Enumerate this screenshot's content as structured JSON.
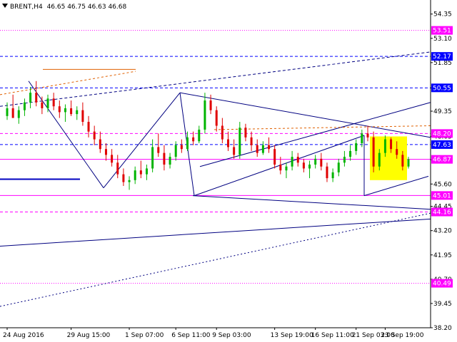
{
  "header": {
    "symbol": "BRENT,H4",
    "ohlc": "46.65 46.75 46.63 46.68"
  },
  "chart_data": {
    "type": "candlestick",
    "title": "BRENT,H4  46.65 46.75 46.63 46.68",
    "ylim": [
      38.2,
      55.0
    ],
    "y_ticks": [
      "54.35",
      "53.10",
      "51.85",
      "50.55",
      "49.35",
      "48.05",
      "46.85",
      "45.60",
      "44.45",
      "43.20",
      "41.95",
      "40.70",
      "39.45",
      "38.20"
    ],
    "x_ticks": [
      "24 Aug 2016",
      "29 Aug 15:00",
      "1 Sep 07:00",
      "6 Sep 11:00",
      "9 Sep 03:00",
      "13 Sep 19:00",
      "16 Sep 11:00",
      "21 Sep 03:00",
      "23 Sep 19:00"
    ],
    "current_price": "46.87",
    "levels": [
      {
        "label": "53.51",
        "value": 53.51,
        "color": "#ff00ff",
        "style": "dotted"
      },
      {
        "label": "52.17",
        "value": 52.17,
        "color": "#0000ff",
        "style": "dashed"
      },
      {
        "label": "50.55",
        "value": 50.55,
        "color": "#0000ff",
        "style": "dashed"
      },
      {
        "label": "48.20",
        "value": 48.2,
        "color": "#ff00ff",
        "style": "dashed"
      },
      {
        "label": "47.63",
        "value": 47.63,
        "color": "#0000ff",
        "style": "dashed"
      },
      {
        "label": "46.87",
        "value": 46.87,
        "color": "#ff00ff",
        "style": "solid"
      },
      {
        "label": "45.01",
        "value": 45.01,
        "color": "#ff00ff",
        "style": "solid"
      },
      {
        "label": "44.16",
        "value": 44.16,
        "color": "#ff00ff",
        "style": "dashed"
      },
      {
        "label": "40.49",
        "value": 40.49,
        "color": "#ff00ff",
        "style": "dotted"
      }
    ],
    "highlight_box_color": "#ffff00",
    "bull_color": "#00b400",
    "bear_color": "#e00000",
    "candles": [
      {
        "x": "24 Aug 2016",
        "o": 49.1,
        "h": 49.8,
        "l": 48.9,
        "c": 49.5
      },
      {
        "o": 49.5,
        "h": 50.2,
        "l": 49.2,
        "c": 49.0
      },
      {
        "o": 49.0,
        "h": 49.6,
        "l": 48.7,
        "c": 49.4
      },
      {
        "o": 49.4,
        "h": 50.0,
        "l": 49.1,
        "c": 49.8
      },
      {
        "o": 49.8,
        "h": 50.6,
        "l": 49.5,
        "c": 50.3
      },
      {
        "o": 50.3,
        "h": 50.9,
        "l": 49.6,
        "c": 49.8
      },
      {
        "o": 49.8,
        "h": 50.1,
        "l": 49.2,
        "c": 49.5
      },
      {
        "o": 49.5,
        "h": 50.2,
        "l": 49.3,
        "c": 50.0
      },
      {
        "o": 50.0,
        "h": 50.3,
        "l": 49.4,
        "c": 49.6
      },
      {
        "o": 49.6,
        "h": 49.9,
        "l": 49.0,
        "c": 49.3
      },
      {
        "o": 49.3,
        "h": 49.7,
        "l": 48.8,
        "c": 49.5
      },
      {
        "x": "29 Aug 15:00",
        "o": 49.5,
        "h": 49.9,
        "l": 49.1,
        "c": 49.2
      },
      {
        "o": 49.2,
        "h": 49.6,
        "l": 48.9,
        "c": 49.4
      },
      {
        "o": 49.4,
        "h": 49.8,
        "l": 48.6,
        "c": 48.8
      },
      {
        "o": 48.8,
        "h": 49.1,
        "l": 48.0,
        "c": 48.3
      },
      {
        "o": 48.3,
        "h": 48.6,
        "l": 47.6,
        "c": 47.9
      },
      {
        "o": 47.9,
        "h": 48.3,
        "l": 47.2,
        "c": 47.4
      },
      {
        "o": 47.4,
        "h": 47.7,
        "l": 46.8,
        "c": 47.1
      },
      {
        "o": 47.1,
        "h": 47.4,
        "l": 46.5,
        "c": 46.7
      },
      {
        "o": 46.7,
        "h": 47.1,
        "l": 45.9,
        "c": 46.1
      },
      {
        "o": 46.1,
        "h": 46.4,
        "l": 45.5,
        "c": 45.7
      },
      {
        "x": "1 Sep 07:00",
        "o": 45.7,
        "h": 46.0,
        "l": 45.3,
        "c": 45.8
      },
      {
        "o": 45.8,
        "h": 46.5,
        "l": 45.6,
        "c": 46.3
      },
      {
        "o": 46.3,
        "h": 46.8,
        "l": 45.9,
        "c": 46.1
      },
      {
        "o": 46.1,
        "h": 46.6,
        "l": 45.8,
        "c": 46.4
      },
      {
        "o": 46.4,
        "h": 47.9,
        "l": 46.2,
        "c": 47.5
      },
      {
        "o": 47.5,
        "h": 48.2,
        "l": 47.0,
        "c": 47.2
      },
      {
        "o": 47.2,
        "h": 47.6,
        "l": 46.3,
        "c": 46.6
      },
      {
        "o": 46.6,
        "h": 47.2,
        "l": 46.4,
        "c": 47.0
      },
      {
        "x": "6 Sep 11:00",
        "o": 47.0,
        "h": 47.8,
        "l": 46.8,
        "c": 47.6
      },
      {
        "o": 47.6,
        "h": 47.9,
        "l": 47.2,
        "c": 47.4
      },
      {
        "o": 47.4,
        "h": 48.3,
        "l": 47.3,
        "c": 48.0
      },
      {
        "o": 48.0,
        "h": 48.3,
        "l": 47.6,
        "c": 47.8
      },
      {
        "o": 47.8,
        "h": 48.6,
        "l": 47.7,
        "c": 48.4
      },
      {
        "o": 48.4,
        "h": 50.3,
        "l": 48.2,
        "c": 49.9
      },
      {
        "o": 49.9,
        "h": 50.2,
        "l": 49.2,
        "c": 49.4
      },
      {
        "x": "9 Sep 03:00",
        "o": 49.4,
        "h": 49.6,
        "l": 48.3,
        "c": 48.6
      },
      {
        "o": 48.6,
        "h": 49.0,
        "l": 47.7,
        "c": 47.9
      },
      {
        "o": 47.9,
        "h": 48.3,
        "l": 47.3,
        "c": 47.5
      },
      {
        "o": 47.5,
        "h": 47.9,
        "l": 46.9,
        "c": 47.1
      },
      {
        "o": 47.1,
        "h": 48.8,
        "l": 46.9,
        "c": 48.5
      },
      {
        "o": 48.5,
        "h": 48.7,
        "l": 47.8,
        "c": 48.0
      },
      {
        "o": 48.0,
        "h": 48.3,
        "l": 47.3,
        "c": 47.6
      },
      {
        "o": 47.6,
        "h": 47.9,
        "l": 47.0,
        "c": 47.2
      },
      {
        "o": 47.2,
        "h": 47.8,
        "l": 47.1,
        "c": 47.6
      },
      {
        "o": 47.6,
        "h": 48.0,
        "l": 47.2,
        "c": 47.4
      },
      {
        "x": "13 Sep 19:00",
        "o": 47.4,
        "h": 47.6,
        "l": 46.4,
        "c": 46.6
      },
      {
        "o": 46.6,
        "h": 47.0,
        "l": 46.1,
        "c": 46.3
      },
      {
        "o": 46.3,
        "h": 46.7,
        "l": 45.9,
        "c": 46.5
      },
      {
        "o": 46.5,
        "h": 47.3,
        "l": 46.3,
        "c": 47.0
      },
      {
        "o": 47.0,
        "h": 47.2,
        "l": 46.5,
        "c": 46.7
      },
      {
        "o": 46.7,
        "h": 46.9,
        "l": 46.2,
        "c": 46.4
      },
      {
        "o": 46.4,
        "h": 46.8,
        "l": 45.9,
        "c": 46.6
      },
      {
        "x": "16 Sep 11:00",
        "o": 46.6,
        "h": 47.1,
        "l": 46.4,
        "c": 46.9
      },
      {
        "o": 46.9,
        "h": 47.2,
        "l": 46.3,
        "c": 46.5
      },
      {
        "o": 46.5,
        "h": 46.7,
        "l": 45.7,
        "c": 45.9
      },
      {
        "o": 45.9,
        "h": 46.4,
        "l": 45.7,
        "c": 46.2
      },
      {
        "o": 46.2,
        "h": 46.9,
        "l": 46.0,
        "c": 46.7
      },
      {
        "o": 46.7,
        "h": 47.3,
        "l": 46.5,
        "c": 47.0
      },
      {
        "o": 47.0,
        "h": 47.6,
        "l": 46.8,
        "c": 47.3
      },
      {
        "x": "21 Sep 03:00",
        "o": 47.3,
        "h": 47.9,
        "l": 47.1,
        "c": 47.7
      },
      {
        "o": 47.7,
        "h": 48.4,
        "l": 47.5,
        "c": 48.2
      },
      {
        "o": 48.2,
        "h": 48.6,
        "l": 47.8,
        "c": 48.0
      },
      {
        "o": 48.0,
        "h": 48.3,
        "l": 46.2,
        "c": 46.5
      },
      {
        "o": 46.5,
        "h": 47.4,
        "l": 46.3,
        "c": 47.2
      },
      {
        "x": "23 Sep 19:00",
        "o": 47.2,
        "h": 48.1,
        "l": 47.0,
        "c": 47.9
      },
      {
        "o": 47.9,
        "h": 48.0,
        "l": 47.2,
        "c": 47.4
      },
      {
        "o": 47.4,
        "h": 47.8,
        "l": 46.9,
        "c": 47.1
      },
      {
        "o": 47.1,
        "h": 47.3,
        "l": 46.3,
        "c": 46.5
      },
      {
        "o": 46.5,
        "h": 47.0,
        "l": 46.4,
        "c": 46.87
      }
    ]
  }
}
